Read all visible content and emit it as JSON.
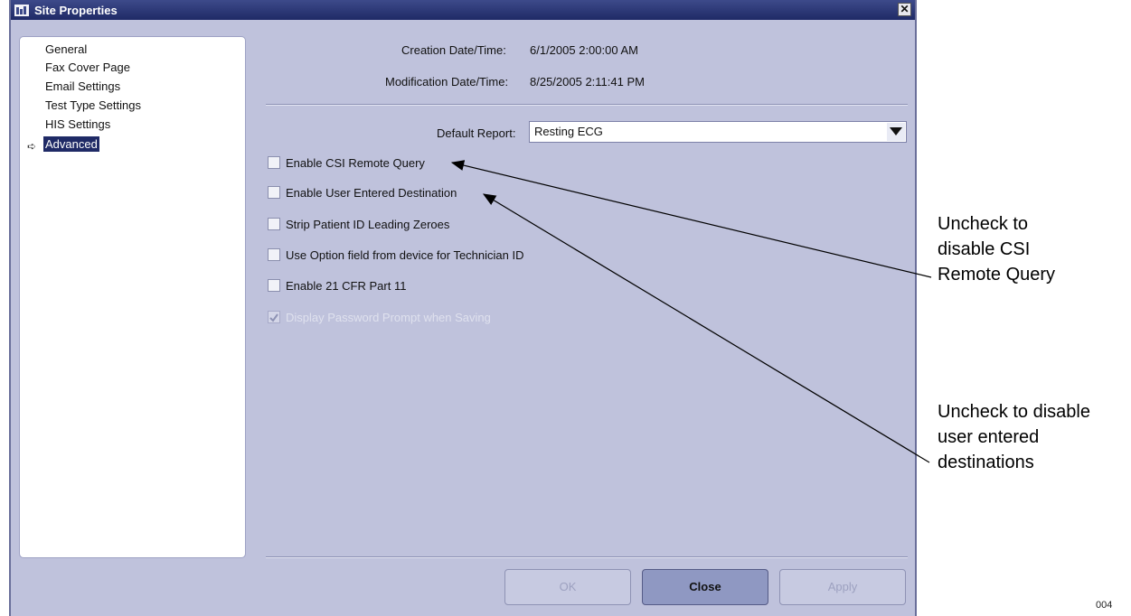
{
  "window": {
    "title": "Site Properties"
  },
  "nav": {
    "items": [
      {
        "label": "General"
      },
      {
        "label": "Fax Cover Page"
      },
      {
        "label": "Email Settings"
      },
      {
        "label": "Test Type Settings"
      },
      {
        "label": "HIS Settings"
      },
      {
        "label": "Advanced"
      }
    ],
    "selected": "Advanced"
  },
  "info": {
    "creation_label": "Creation Date/Time:",
    "creation_value": "6/1/2005 2:00:00 AM",
    "modification_label": "Modification Date/Time:",
    "modification_value": "8/25/2005 2:11:41 PM"
  },
  "default_report": {
    "label": "Default Report:",
    "value": "Resting ECG"
  },
  "options": [
    {
      "label": "Enable CSI Remote Query",
      "checked": false,
      "enabled": true
    },
    {
      "label": "Enable User Entered Destination",
      "checked": false,
      "enabled": true
    },
    {
      "label": "Strip Patient ID Leading Zeroes",
      "checked": false,
      "enabled": true
    },
    {
      "label": "Use Option field from device for Technician ID",
      "checked": false,
      "enabled": true
    },
    {
      "label": "Enable 21 CFR Part 11",
      "checked": false,
      "enabled": true
    },
    {
      "label": "Display Password Prompt when Saving",
      "checked": true,
      "enabled": false
    }
  ],
  "buttons": {
    "ok": "OK",
    "close": "Close",
    "apply": "Apply"
  },
  "annotations": {
    "csi": [
      "Uncheck to",
      "disable CSI",
      "Remote Query"
    ],
    "user_dest": [
      "Uncheck to disable",
      "user entered",
      "destinations"
    ]
  },
  "figure_number": "004",
  "colors": {
    "titlebar": "#1f2a66",
    "panel": "#bfc2dc",
    "selected": "#1f2a66"
  }
}
